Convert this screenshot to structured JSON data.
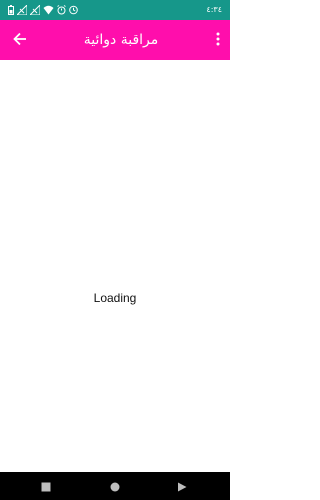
{
  "status_bar": {
    "time": "٤:٣٤",
    "icons": [
      "battery-icon",
      "signal-icon",
      "signal-icon",
      "wifi-icon",
      "alarm-icon",
      "clock-icon"
    ],
    "background": "#16978a"
  },
  "app_bar": {
    "title": "مراقبة دوائية",
    "background": "#ff0eac",
    "back_icon": "arrow-back-icon",
    "menu_icon": "more-vert-icon"
  },
  "content": {
    "loading_text": "Loading"
  },
  "nav_bar": {
    "icons": [
      "recents-square-icon",
      "home-circle-icon",
      "back-triangle-icon"
    ]
  }
}
